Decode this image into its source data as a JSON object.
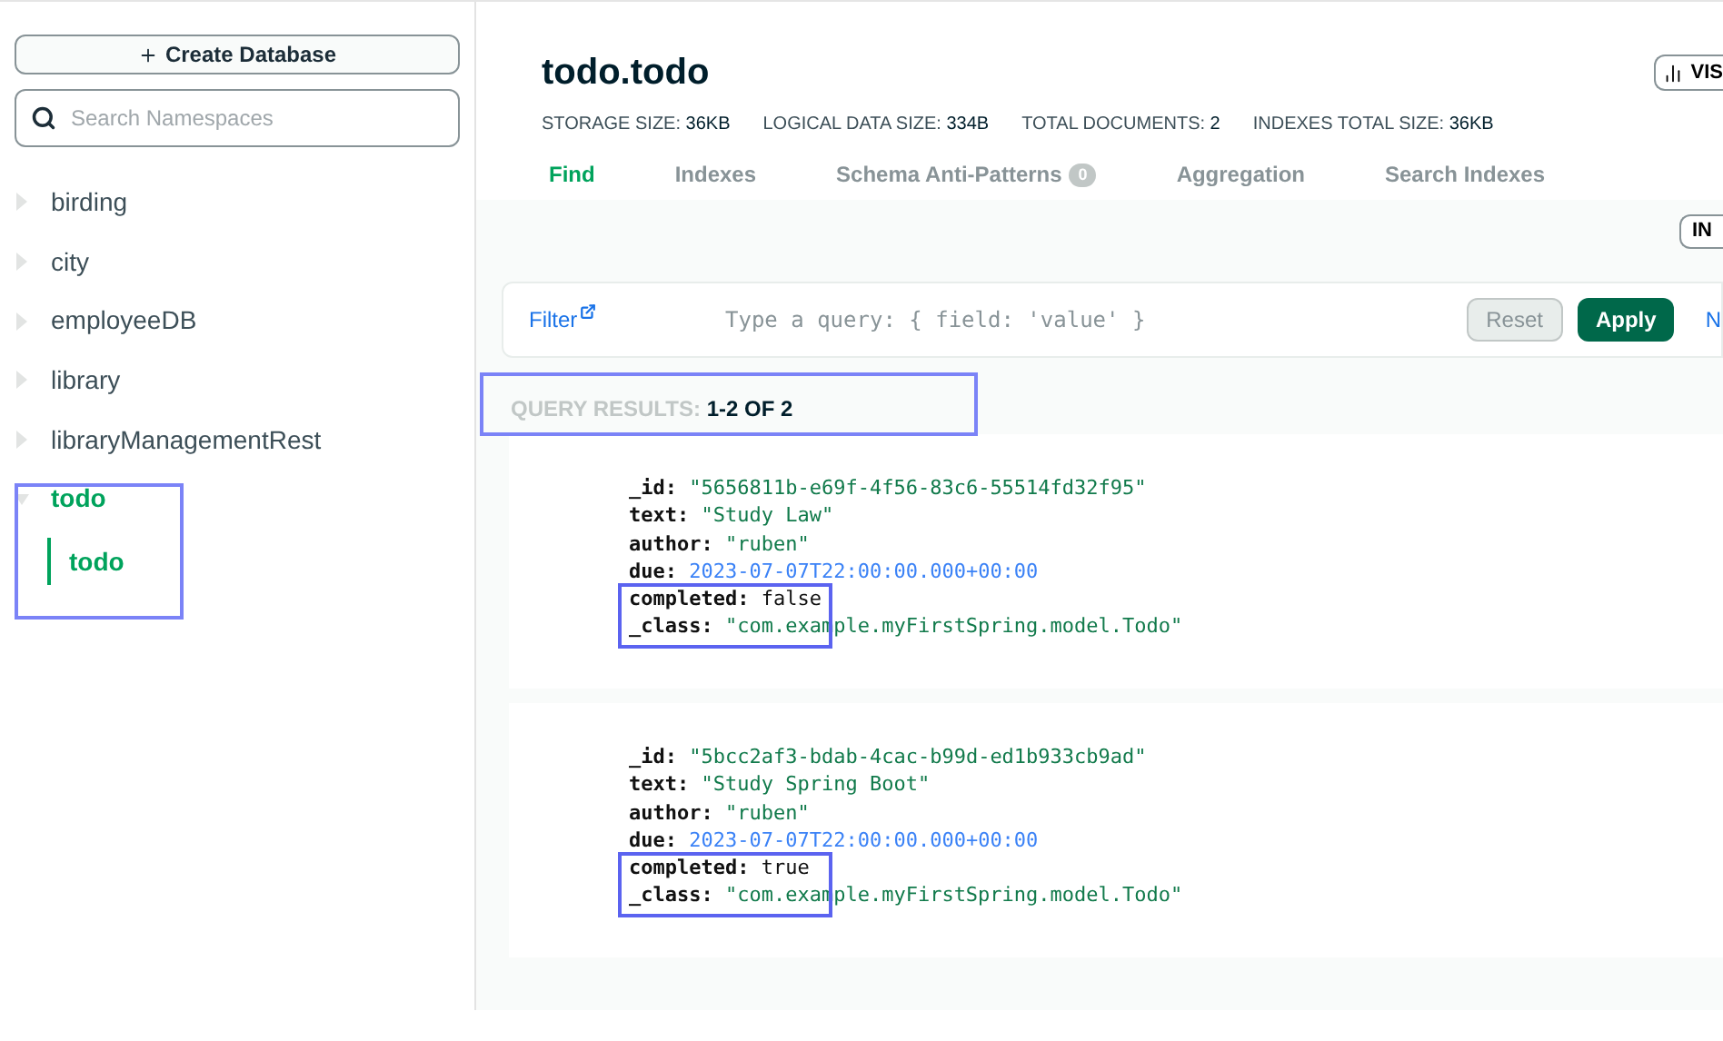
{
  "sidebar": {
    "create_button": "Create Database",
    "search": {
      "placeholder": "Search Namespaces"
    },
    "databases": [
      {
        "name": "birding",
        "expanded": false
      },
      {
        "name": "city",
        "expanded": false
      },
      {
        "name": "employeeDB",
        "expanded": false
      },
      {
        "name": "library",
        "expanded": false
      },
      {
        "name": "libraryManagementRest",
        "expanded": false
      },
      {
        "name": "todo",
        "expanded": true,
        "children": [
          {
            "name": "todo",
            "selected": true
          }
        ]
      }
    ]
  },
  "header": {
    "title": "todo.todo",
    "visualize_button": "VIS",
    "stats": [
      {
        "label": "STORAGE SIZE:",
        "value": "36KB"
      },
      {
        "label": "LOGICAL DATA SIZE:",
        "value": "334B"
      },
      {
        "label": "TOTAL DOCUMENTS:",
        "value": "2"
      },
      {
        "label": "INDEXES TOTAL SIZE:",
        "value": "36KB"
      }
    ],
    "tabs": [
      {
        "label": "Find",
        "selected": true
      },
      {
        "label": "Indexes",
        "selected": false
      },
      {
        "label": "Schema Anti-Patterns",
        "selected": false,
        "badge": "0"
      },
      {
        "label": "Aggregation",
        "selected": false
      },
      {
        "label": "Search Indexes",
        "selected": false
      }
    ]
  },
  "toolbar": {
    "insert_button": "IN"
  },
  "filter": {
    "label": "Filter",
    "placeholder": "Type a query: { field: 'value' }",
    "reset": "Reset",
    "apply": "Apply",
    "more": "N"
  },
  "results": {
    "label": "QUERY RESULTS:",
    "range": "1-2 OF 2"
  },
  "documents": [
    {
      "fields": [
        {
          "key": "_id:",
          "value": "\"5656811b-e69f-4f56-83c6-55514fd32f95\"",
          "kind": "string"
        },
        {
          "key": "text:",
          "value": "\"Study Law\"",
          "kind": "string"
        },
        {
          "key": "author:",
          "value": "\"ruben\"",
          "kind": "string"
        },
        {
          "key": "due:",
          "value": "2023-07-07T22:00:00.000+00:00",
          "kind": "date"
        },
        {
          "key": "completed:",
          "value": "false",
          "kind": "boolean"
        },
        {
          "key": "_class:",
          "value": "\"com.example.myFirstSpring.model.Todo\"",
          "kind": "string"
        }
      ]
    },
    {
      "fields": [
        {
          "key": "_id:",
          "value": "\"5bcc2af3-bdab-4cac-b99d-ed1b933cb9ad\"",
          "kind": "string"
        },
        {
          "key": "text:",
          "value": "\"Study Spring Boot\"",
          "kind": "string"
        },
        {
          "key": "author:",
          "value": "\"ruben\"",
          "kind": "string"
        },
        {
          "key": "due:",
          "value": "2023-07-07T22:00:00.000+00:00",
          "kind": "date"
        },
        {
          "key": "completed:",
          "value": "true",
          "kind": "boolean"
        },
        {
          "key": "_class:",
          "value": "\"com.example.myFirstSpring.model.Todo\"",
          "kind": "string"
        }
      ]
    }
  ]
}
